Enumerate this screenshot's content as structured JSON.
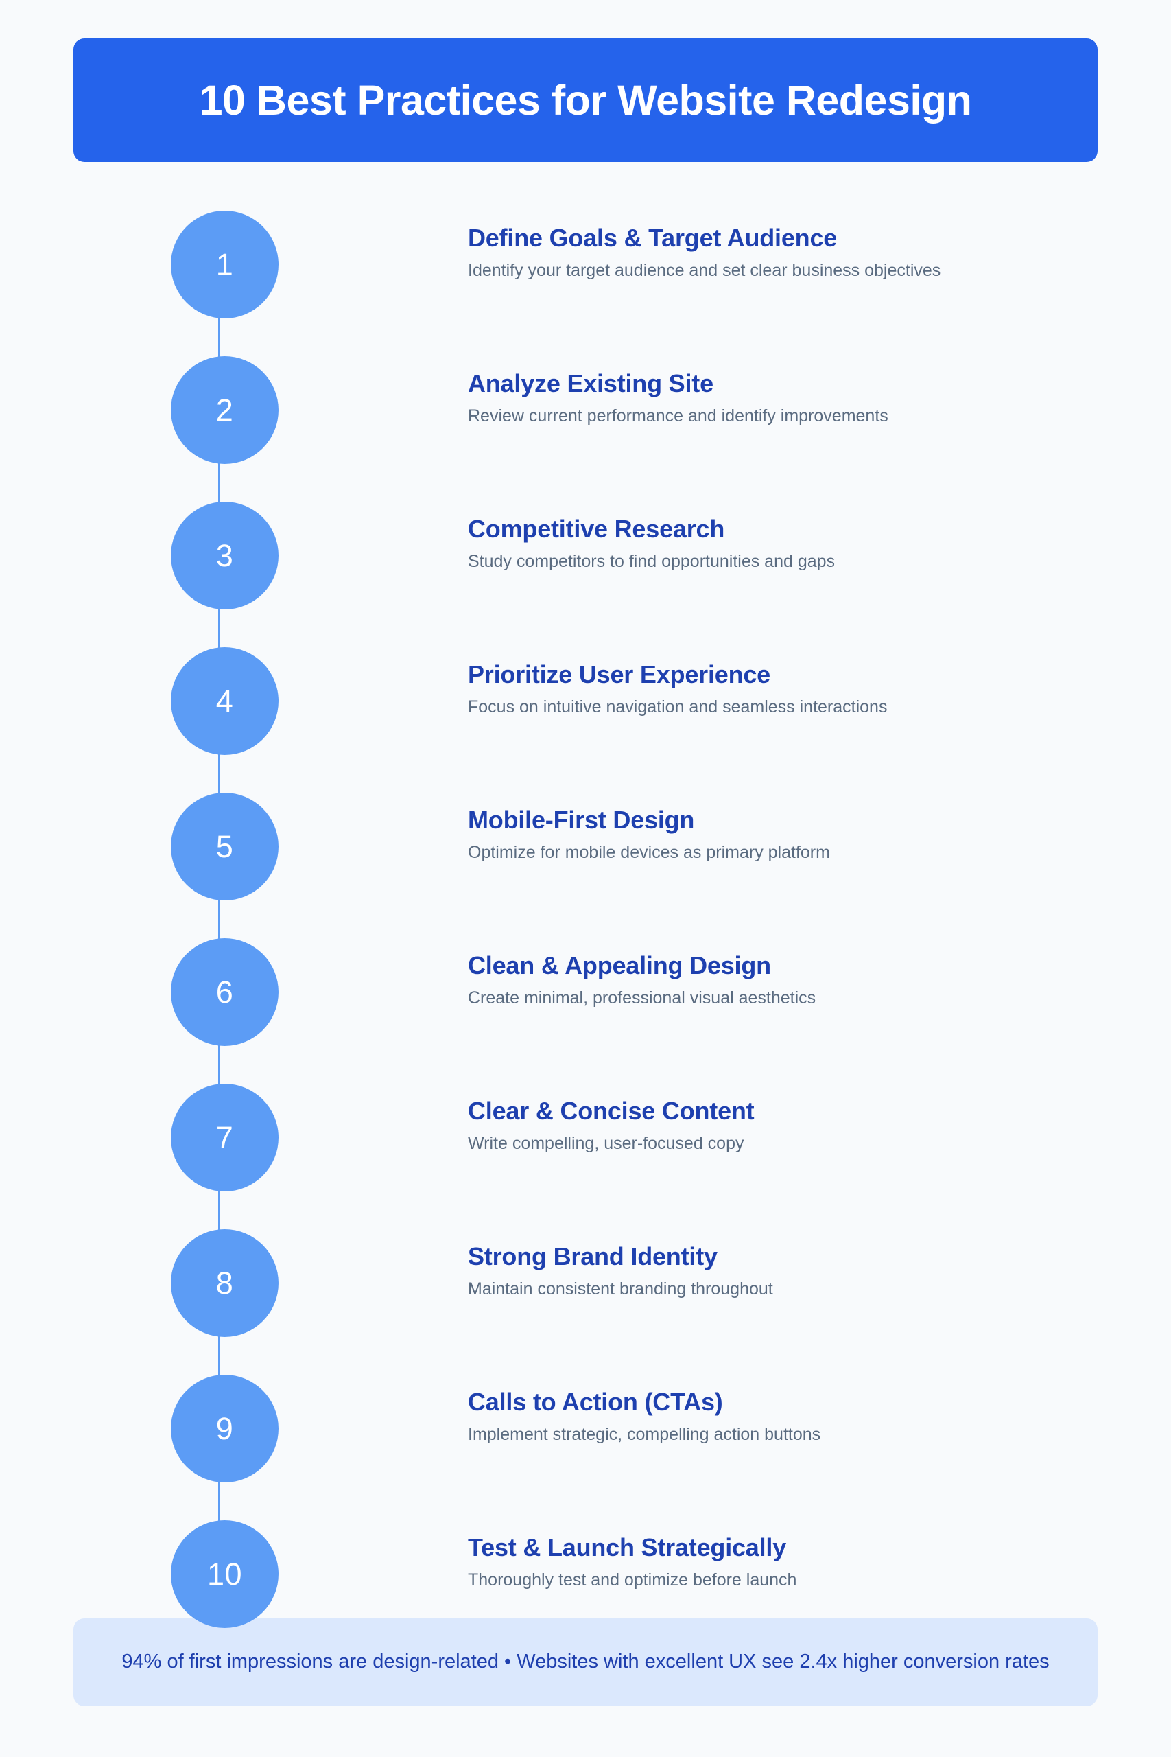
{
  "header": {
    "title": "10 Best Practices for Website Redesign",
    "background_color": "#2563eb",
    "text_color": "#ffffff"
  },
  "theme": {
    "page_background": "#f8fafc",
    "circle_color": "#5c9cf5",
    "connector_color": "#5c9cf5",
    "title_color": "#1e40af",
    "description_color": "#5a6b80",
    "footer_background": "#dbe8fd",
    "footer_text_color": "#1e3fae"
  },
  "steps": [
    {
      "number": "1",
      "title": "Define Goals & Target Audience",
      "description": "Identify your target audience and set clear business objectives"
    },
    {
      "number": "2",
      "title": "Analyze Existing Site",
      "description": "Review current performance and identify improvements"
    },
    {
      "number": "3",
      "title": "Competitive Research",
      "description": "Study competitors to find opportunities and gaps"
    },
    {
      "number": "4",
      "title": "Prioritize User Experience",
      "description": "Focus on intuitive navigation and seamless interactions"
    },
    {
      "number": "5",
      "title": "Mobile-First Design",
      "description": "Optimize for mobile devices as primary platform"
    },
    {
      "number": "6",
      "title": "Clean & Appealing Design",
      "description": "Create minimal, professional visual aesthetics"
    },
    {
      "number": "7",
      "title": "Clear & Concise Content",
      "description": "Write compelling, user-focused copy"
    },
    {
      "number": "8",
      "title": "Strong Brand Identity",
      "description": "Maintain consistent branding throughout"
    },
    {
      "number": "9",
      "title": "Calls to Action (CTAs)",
      "description": "Implement strategic, compelling action buttons"
    },
    {
      "number": "10",
      "title": "Test & Launch Strategically",
      "description": "Thoroughly test and optimize before launch"
    }
  ],
  "footer": {
    "text": "94% of first impressions are design-related • Websites with excellent UX see 2.4x higher conversion rates"
  }
}
